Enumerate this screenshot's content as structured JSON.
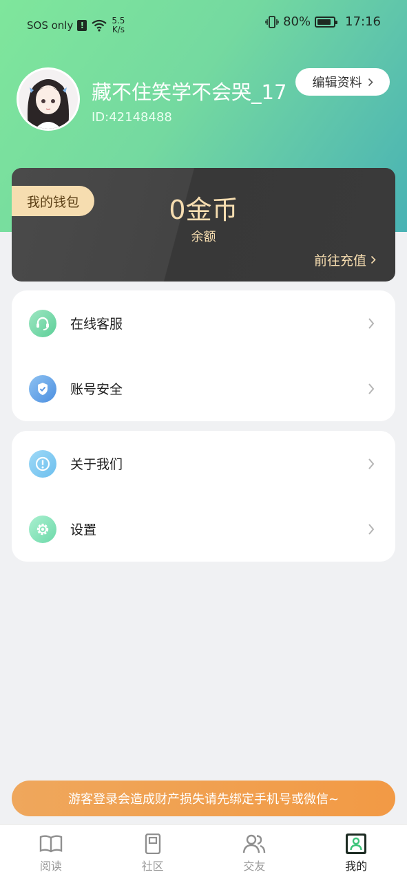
{
  "status_bar": {
    "carrier": "SOS only",
    "net_speed_value": "5.5",
    "net_speed_unit": "K/s",
    "battery": "80%",
    "time": "17:16"
  },
  "profile": {
    "username": "藏不住笑学不会哭_17",
    "user_id": "ID:42148488",
    "edit_button": "编辑资料"
  },
  "wallet": {
    "tag": "我的钱包",
    "amount": "0金币",
    "amount_label": "余额",
    "recharge": "前往充值"
  },
  "menu_groups": [
    {
      "items": [
        {
          "label": "在线客服",
          "icon": "headset-icon"
        },
        {
          "label": "账号安全",
          "icon": "shield-icon"
        }
      ]
    },
    {
      "items": [
        {
          "label": "关于我们",
          "icon": "info-icon"
        },
        {
          "label": "设置",
          "icon": "gear-icon"
        }
      ]
    }
  ],
  "notice": "游客登录会造成财产损失请先绑定手机号或微信~",
  "tabs": [
    {
      "label": "阅读",
      "icon": "book-icon"
    },
    {
      "label": "社区",
      "icon": "community-icon"
    },
    {
      "label": "交友",
      "icon": "friends-icon"
    },
    {
      "label": "我的",
      "icon": "profile-icon",
      "active": true
    }
  ],
  "colors": {
    "hero_gradient_start": "#7fe69c",
    "hero_gradient_end": "#48b2b4",
    "wallet_bg": "#404040",
    "gold": "#f6ddb0",
    "notice_orange": "#f29a45"
  }
}
